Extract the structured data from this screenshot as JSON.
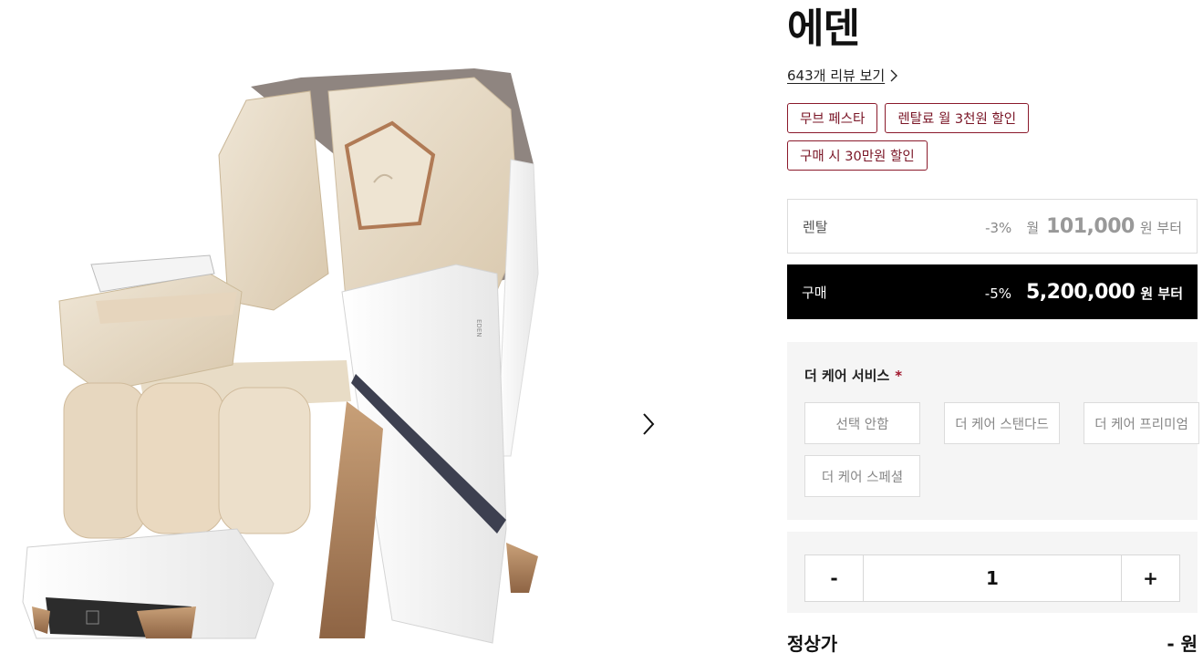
{
  "product": {
    "title": "에덴",
    "review_link": "643개 리뷰 보기",
    "tags": [
      "무브 페스타",
      "렌탈료 월 3천원 할인",
      "구매 시 30만원 할인"
    ]
  },
  "pricing": {
    "rental": {
      "label": "렌탈",
      "discount": "-3%",
      "prefix": "월",
      "amount": "101,000",
      "unit": "원 부터"
    },
    "buy": {
      "label": "구매",
      "discount": "-5%",
      "amount": "5,200,000",
      "unit": "원 부터"
    }
  },
  "care_service": {
    "title": "더 케어 서비스",
    "required_mark": "*",
    "options": [
      "선택 안함",
      "더 케어 스탠다드",
      "더 케어 프리미엄",
      "더 케어 스페셜"
    ]
  },
  "quantity": {
    "minus": "-",
    "value": "1",
    "plus": "+"
  },
  "regular_price": {
    "label": "정상가",
    "value": "- 원"
  },
  "product_image": {
    "brand_text": "EDEN"
  },
  "colors": {
    "accent": "#8b1a2b",
    "buy_bg": "#000000",
    "panel_bg": "#f5f5f5"
  },
  "icons": {
    "review_arrow": "chevron-right-icon",
    "gallery_next": "chevron-right-icon"
  }
}
